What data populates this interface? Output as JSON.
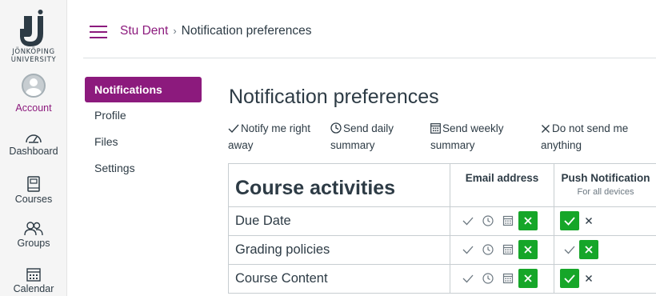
{
  "colors": {
    "brand": "#8c1a7d",
    "selected": "#16a629",
    "text": "#2d3b45",
    "muted": "#6b7780"
  },
  "logo": {
    "line1": "JÖNKÖPING",
    "line2": "UNIVERSITY"
  },
  "global_nav": [
    {
      "id": "account",
      "label": "Account",
      "icon": "avatar-icon"
    },
    {
      "id": "dashboard",
      "label": "Dashboard",
      "icon": "speedometer-icon"
    },
    {
      "id": "courses",
      "label": "Courses",
      "icon": "book-icon"
    },
    {
      "id": "groups",
      "label": "Groups",
      "icon": "people-icon"
    },
    {
      "id": "calendar",
      "label": "Calendar",
      "icon": "calendar-icon"
    }
  ],
  "breadcrumb": {
    "user": "Stu Dent",
    "separator": "›",
    "current": "Notification preferences"
  },
  "section_nav": [
    {
      "label": "Notifications",
      "active": true
    },
    {
      "label": "Profile",
      "active": false
    },
    {
      "label": "Files",
      "active": false
    },
    {
      "label": "Settings",
      "active": false
    }
  ],
  "page_title": "Notification preferences",
  "legend": [
    {
      "icon": "check-icon",
      "label": "Notify me right away"
    },
    {
      "icon": "clock-icon",
      "label": "Send daily summary"
    },
    {
      "icon": "calendar-icon",
      "label": "Send weekly summary"
    },
    {
      "icon": "x-icon",
      "label": "Do not send me anything"
    }
  ],
  "table": {
    "category_title": "Course activities",
    "columns": {
      "email": {
        "label": "Email address"
      },
      "push": {
        "label": "Push Notification",
        "sublabel": "For all devices"
      }
    },
    "rows": [
      {
        "label": "Due Date",
        "email_selected": "none",
        "push_selected": "immediately"
      },
      {
        "label": "Grading policies",
        "email_selected": "none",
        "push_selected": "none"
      },
      {
        "label": "Course Content",
        "email_selected": "none",
        "push_selected": "immediately"
      }
    ]
  }
}
